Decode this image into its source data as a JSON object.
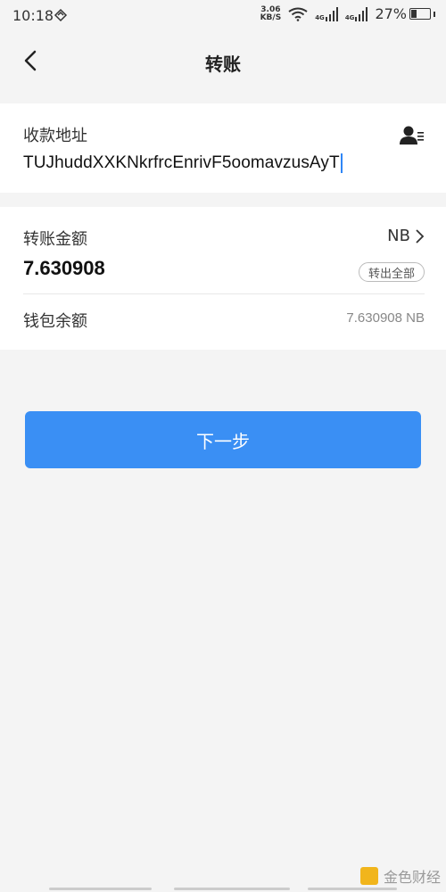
{
  "status_bar": {
    "time": "10:18",
    "speed_value": "3.06",
    "speed_unit": "KB/S",
    "net1": "4G",
    "net2": "4G",
    "battery": "27%",
    "battery_level": 0.27
  },
  "nav": {
    "title": "转账"
  },
  "recipient": {
    "label": "收款地址",
    "address": "TUJhuddXXKNkrfrcEnrivF5oomavzusAyT"
  },
  "amount": {
    "label": "转账金额",
    "unit": "NB",
    "value": "7.630908",
    "transfer_all_label": "转出全部"
  },
  "balance": {
    "label": "钱包余额",
    "value": "7.630908 NB"
  },
  "next_button": {
    "label": "下一步"
  },
  "watermark": {
    "text": "金色财经"
  },
  "colors": {
    "accent": "#3a8ff4",
    "background": "#f4f4f4",
    "caret": "#2f86f6"
  }
}
